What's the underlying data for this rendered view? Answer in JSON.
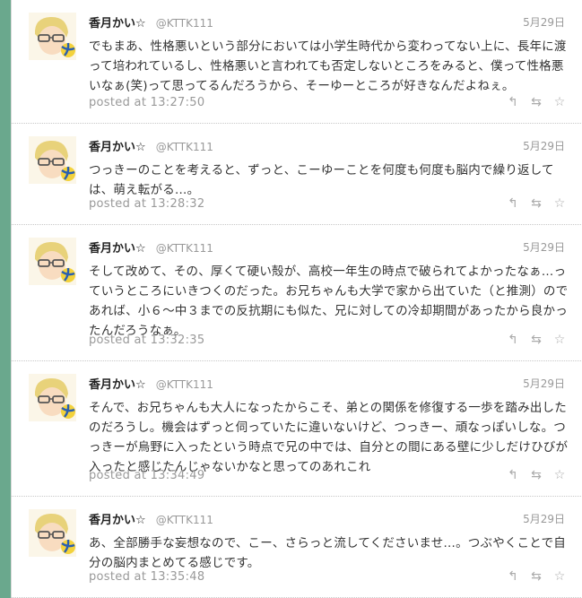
{
  "tweets": [
    {
      "name": "香月かい☆",
      "handle": "@KTTK111",
      "date": "5月29日",
      "text": "でもまあ、性格悪いという部分においては小学生時代から変わってない上に、長年に渡って培われているし、性格悪いと言われても否定しないところをみると、僕って性格悪いなぁ(笑)って思ってるんだろうから、そーゆーところが好きなんだよねぇ。",
      "posted": "posted at 13:27:50"
    },
    {
      "name": "香月かい☆",
      "handle": "@KTTK111",
      "date": "5月29日",
      "text": "つっきーのことを考えると、ずっと、こーゆーことを何度も何度も脳内で繰り返しては、萌え転がる…。",
      "posted": "posted at 13:28:32"
    },
    {
      "name": "香月かい☆",
      "handle": "@KTTK111",
      "date": "5月29日",
      "text": "そして改めて、その、厚くて硬い殻が、高校一年生の時点で破られてよかったなぁ…っていうところにいきつくのだった。お兄ちゃんも大学で家から出ていた（と推測）のであれば、小６～中３までの反抗期にも似た、兄に対しての冷却期間があったから良かったんだろうなぁ。",
      "posted": "posted at 13:32:35"
    },
    {
      "name": "香月かい☆",
      "handle": "@KTTK111",
      "date": "5月29日",
      "text": "そんで、お兄ちゃんも大人になったからこそ、弟との関係を修復する一歩を踏み出したのだろうし。機会はずっと伺っていたに違いないけど、つっきー、頑なっぽいしな。つっきーが烏野に入ったという時点で兄の中では、自分との間にある壁に少しだけひびが入ったと感じたんじゃないかなと思ってのあれこれ",
      "posted": "posted at 13:34:49"
    },
    {
      "name": "香月かい☆",
      "handle": "@KTTK111",
      "date": "5月29日",
      "text": "あ、全部勝手な妄想なので、こー、さらっと流してくださいませ…。つぶやくことで自分の脳内まとめてる感じです。",
      "posted": "posted at 13:35:48"
    }
  ],
  "icons": {
    "reply": "↰",
    "retweet": "⇆",
    "favorite": "☆"
  }
}
